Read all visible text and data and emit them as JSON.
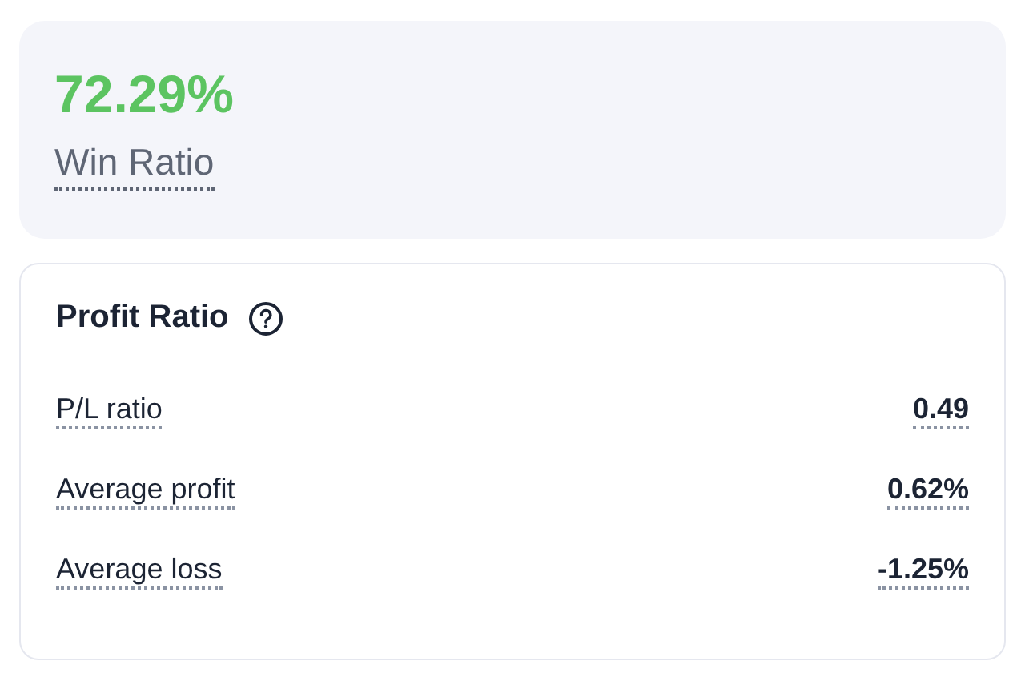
{
  "win_card": {
    "value": "72.29%",
    "label": "Win Ratio"
  },
  "profit_card": {
    "title": "Profit Ratio",
    "rows": [
      {
        "label": "P/L ratio",
        "value": "0.49"
      },
      {
        "label": "Average profit",
        "value": "0.62%"
      },
      {
        "label": "Average loss",
        "value": "-1.25%"
      }
    ]
  }
}
